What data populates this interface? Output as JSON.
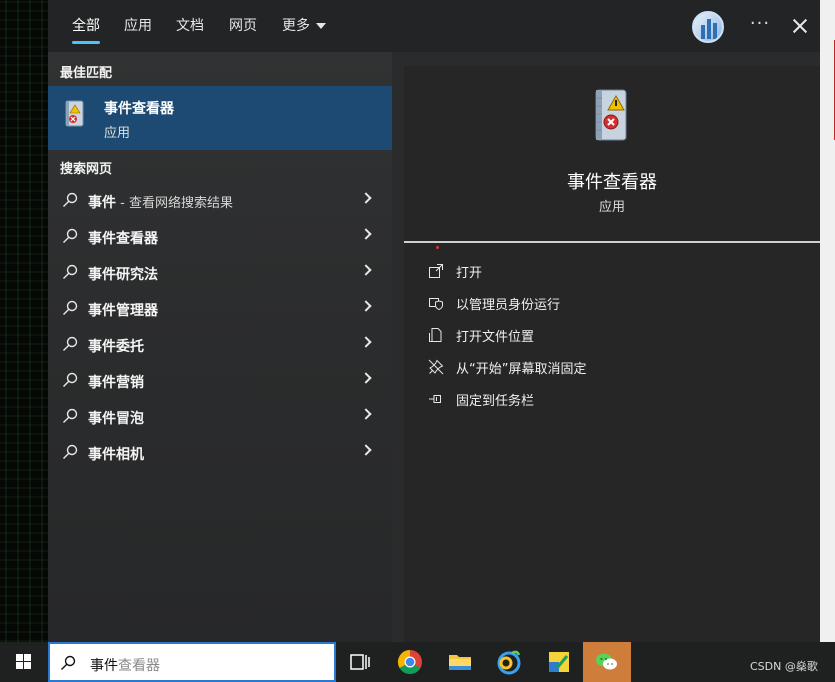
{
  "tabs": [
    {
      "label": "全部",
      "active": true
    },
    {
      "label": "应用"
    },
    {
      "label": "文档"
    },
    {
      "label": "网页"
    },
    {
      "label": "更多"
    }
  ],
  "more_menu_glyph": "···",
  "sections": {
    "best_match": "最佳匹配",
    "search_web": "搜索网页"
  },
  "best_match": {
    "name": "事件查看器",
    "type": "应用",
    "icon": "event-viewer-icon"
  },
  "web_results": [
    {
      "label": "事件",
      "sub": " - 查看网络搜索结果"
    },
    {
      "label": "事件查看器",
      "sub": ""
    },
    {
      "label": "事件研究法",
      "sub": ""
    },
    {
      "label": "事件管理器",
      "sub": ""
    },
    {
      "label": "事件委托",
      "sub": ""
    },
    {
      "label": "事件营销",
      "sub": ""
    },
    {
      "label": "事件冒泡",
      "sub": ""
    },
    {
      "label": "事件相机",
      "sub": ""
    }
  ],
  "detail": {
    "title": "事件查看器",
    "subtitle": "应用",
    "actions": [
      {
        "label": "打开",
        "icon": "open-icon"
      },
      {
        "label": "以管理员身份运行",
        "icon": "shield-icon"
      },
      {
        "label": "打开文件位置",
        "icon": "file-location-icon"
      },
      {
        "label": "从“开始”屏幕取消固定",
        "icon": "unpin-icon"
      },
      {
        "label": "固定到任务栏",
        "icon": "pin-icon"
      }
    ]
  },
  "taskbar": {
    "search_typed": "事件",
    "search_hint": "查看器",
    "icons": [
      "task-view-icon",
      "chrome-icon",
      "file-explorer-icon",
      "browser-icon",
      "app-icon",
      "wechat-icon"
    ],
    "watermark": "CSDN @燊歌"
  },
  "colors": {
    "accent": "#4cc2ff",
    "selected": "#1c4a73",
    "panel": "#2a2b2c"
  }
}
